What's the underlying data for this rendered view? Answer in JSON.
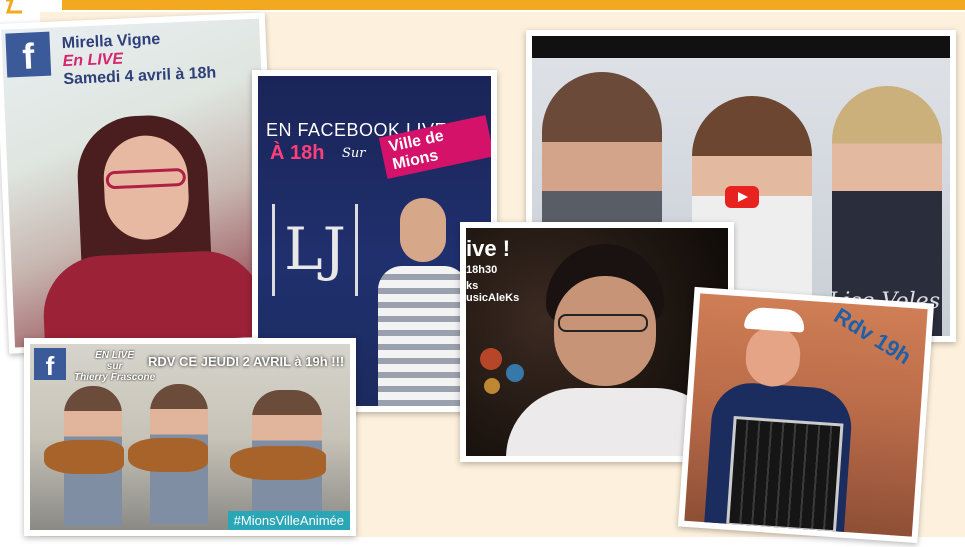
{
  "mirella": {
    "fb_letter": "f",
    "name": "Mirella Vigne",
    "live": "En LIVE",
    "date": "Samedi 4 avril à 18h"
  },
  "lj_poster": {
    "headline": "EN FACEBOOK LIVE",
    "time": "À 18h",
    "sur": "Sur",
    "place": "Ville de Mions",
    "logo": "LJ"
  },
  "trio_video": {
    "signature": "Lise Voles"
  },
  "guitar_photo": {
    "fb_letter": "f",
    "en_live": "EN LIVE",
    "sur": "sur",
    "host": "Thierry Frascone",
    "rdv": "RDV CE JEUDI 2 AVRIL à 19h !!!",
    "hashtag": "#MionsVilleAnimée"
  },
  "aleks_photo": {
    "title": "ive !",
    "time": "18h30",
    "line1": "ks",
    "line2": "usicAleKs"
  },
  "accordion_photo": {
    "rdv": "Rdv 19h"
  },
  "colors": {
    "accent_orange": "#f2a81f",
    "cream": "#fdf0dc",
    "facebook_blue": "#3b5a9a",
    "pink": "#d4126a",
    "teal": "#2aa6b7"
  }
}
